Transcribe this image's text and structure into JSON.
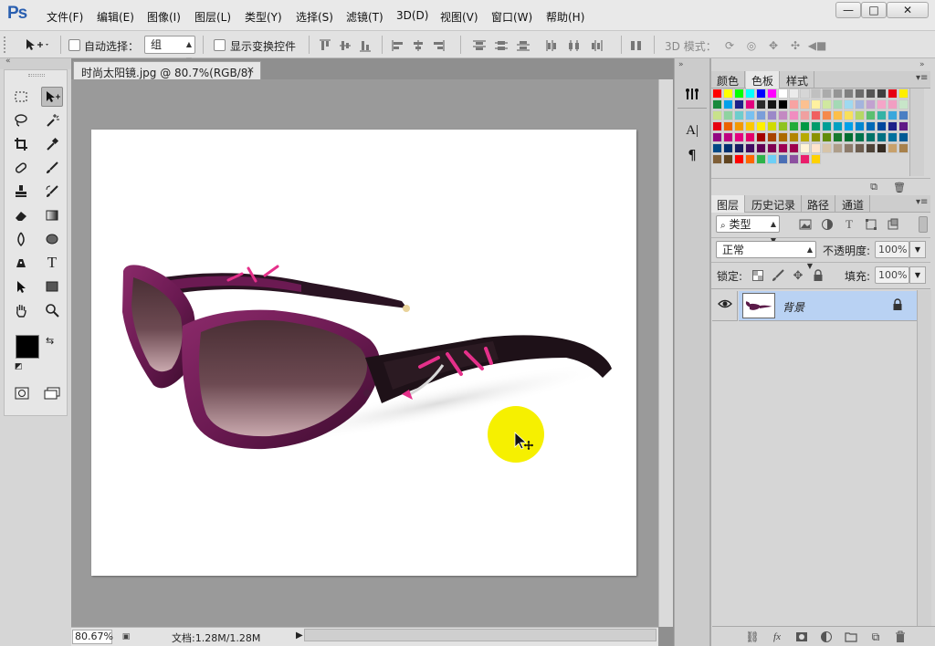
{
  "app": {
    "logo": "Ps"
  },
  "menu": [
    "文件(F)",
    "编辑(E)",
    "图像(I)",
    "图层(L)",
    "类型(Y)",
    "选择(S)",
    "滤镜(T)",
    "3D(D)",
    "视图(V)",
    "窗口(W)",
    "帮助(H)"
  ],
  "window_controls": {
    "minimize": "—",
    "restore": "□",
    "close": "✕"
  },
  "options": {
    "auto_select_label": "自动选择：",
    "auto_select_value": "组",
    "show_transform_label": "显示变换控件",
    "mode_3d_label": "3D 模式："
  },
  "document": {
    "tab_title": "时尚太阳镜.jpg @ 80.7%(RGB/8)",
    "tab_close": "×",
    "zoom": "80.67%",
    "doc_size": "文档:1.28M/1.28M"
  },
  "color_panel": {
    "tabs": [
      "颜色",
      "色板",
      "样式"
    ],
    "active_tab": 1
  },
  "swatch_colors": [
    "#ff0000",
    "#ffff00",
    "#00ff00",
    "#00ffff",
    "#0000ff",
    "#ff00ff",
    "#ffffff",
    "#ebebeb",
    "#d6d6d6",
    "#c0c0c0",
    "#ababab",
    "#959595",
    "#808080",
    "#6b6b6b",
    "#555555",
    "#404040",
    "#e60012",
    "#ffef00",
    "#1a8a3c",
    "#00a0e9",
    "#1d2088",
    "#e4007f",
    "#2b2b2b",
    "#151515",
    "#000000",
    "#f7a3a3",
    "#fbc090",
    "#fff1a0",
    "#d0e8a0",
    "#a4d9b5",
    "#9fd9f0",
    "#a4b4dd",
    "#c2a2d0",
    "#f5a5c8",
    "#f19ec2",
    "#c8e6c9",
    "#c8e28b",
    "#8fd3a0",
    "#6ecdcd",
    "#78c0f0",
    "#7a9ed9",
    "#9b88c8",
    "#c389c2",
    "#f08dc0",
    "#f0a0a0",
    "#f06060",
    "#f58a4b",
    "#fcbf49",
    "#f8e05c",
    "#b6d765",
    "#5bbf70",
    "#34b3a5",
    "#3ba7dc",
    "#4b7fc3",
    "#e60012",
    "#eb6100",
    "#f39800",
    "#fcc800",
    "#fff100",
    "#cfdb00",
    "#8fc31f",
    "#22ac38",
    "#009944",
    "#009b6b",
    "#009e96",
    "#00a0c1",
    "#00a0e9",
    "#0086d1",
    "#0068b7",
    "#00479d",
    "#1d2088",
    "#601986",
    "#920783",
    "#be0081",
    "#e4007f",
    "#e5006a",
    "#a40000",
    "#a84200",
    "#ac6a00",
    "#b28500",
    "#b7aa00",
    "#8a9200",
    "#638c0b",
    "#187a2f",
    "#006e30",
    "#00734b",
    "#007368",
    "#007183",
    "#00719e",
    "#005b95",
    "#004986",
    "#00306f",
    "#171c61",
    "#400b61",
    "#620055",
    "#800052",
    "#9d0055",
    "#9e004e",
    "#fff4d8",
    "#ffe4cc",
    "#d7c4a8",
    "#ae9e8a",
    "#8c7b6b",
    "#6c5d4f",
    "#4e4338",
    "#342a21",
    "#c8a16b",
    "#a8814b",
    "#7f5f37",
    "#60441f",
    "#ff0000",
    "#ff6600",
    "#2db34a",
    "#6dcff6",
    "#4a6fb5",
    "#8c50a0",
    "#ea1e6b",
    "#ffd100"
  ],
  "layers_panel": {
    "tabs": [
      "图层",
      "历史记录",
      "路径",
      "通道"
    ],
    "active_tab": 0,
    "filter_label": "类型",
    "blend_mode": "正常",
    "opacity_label": "不透明度:",
    "opacity_value": "100%",
    "lock_label": "锁定:",
    "fill_label": "填充:",
    "fill_value": "100%",
    "layers": [
      {
        "name": "背景",
        "locked": true,
        "visible": true
      }
    ]
  },
  "colors": {
    "foreground": "#000000",
    "background": "#ffffff",
    "layer_selected": "#b9d2f3",
    "cursor_highlight": "#f6f000"
  }
}
